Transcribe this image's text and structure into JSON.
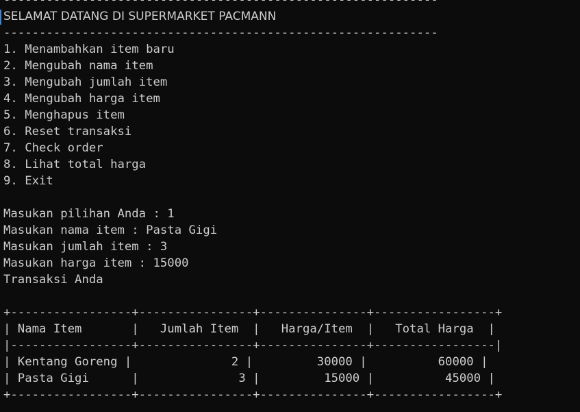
{
  "rule": "-------------------------------------------------------------",
  "title": "SELAMAT DATANG DI SUPERMARKET PACMANN",
  "menu": [
    "1. Menambahkan item baru",
    "2. Mengubah nama item",
    "3. Mengubah jumlah item",
    "4. Mengubah harga item",
    "5. Menghapus item",
    "6. Reset transaksi",
    "7. Check order",
    "8. Lihat total harga",
    "9. Exit"
  ],
  "prompts": [
    "Masukan pilihan Anda : 1",
    "Masukan nama item : Pasta Gigi",
    "Masukan jumlah item : 3",
    "Masukan harga item : 15000"
  ],
  "transaction_label": "Transaksi Anda",
  "table": {
    "border": "+-----------------+----------------+---------------+-----------------+",
    "header": "| Nama Item       |   Jumlah Item  |   Harga/Item  |   Total Harga  |",
    "separator": "|-----------------+----------------+---------------+-----------------|",
    "rows": [
      "| Kentang Goreng |              2 |         30000 |          60000 |",
      "| Pasta Gigi      |              3 |         15000 |          45000 |"
    ]
  }
}
